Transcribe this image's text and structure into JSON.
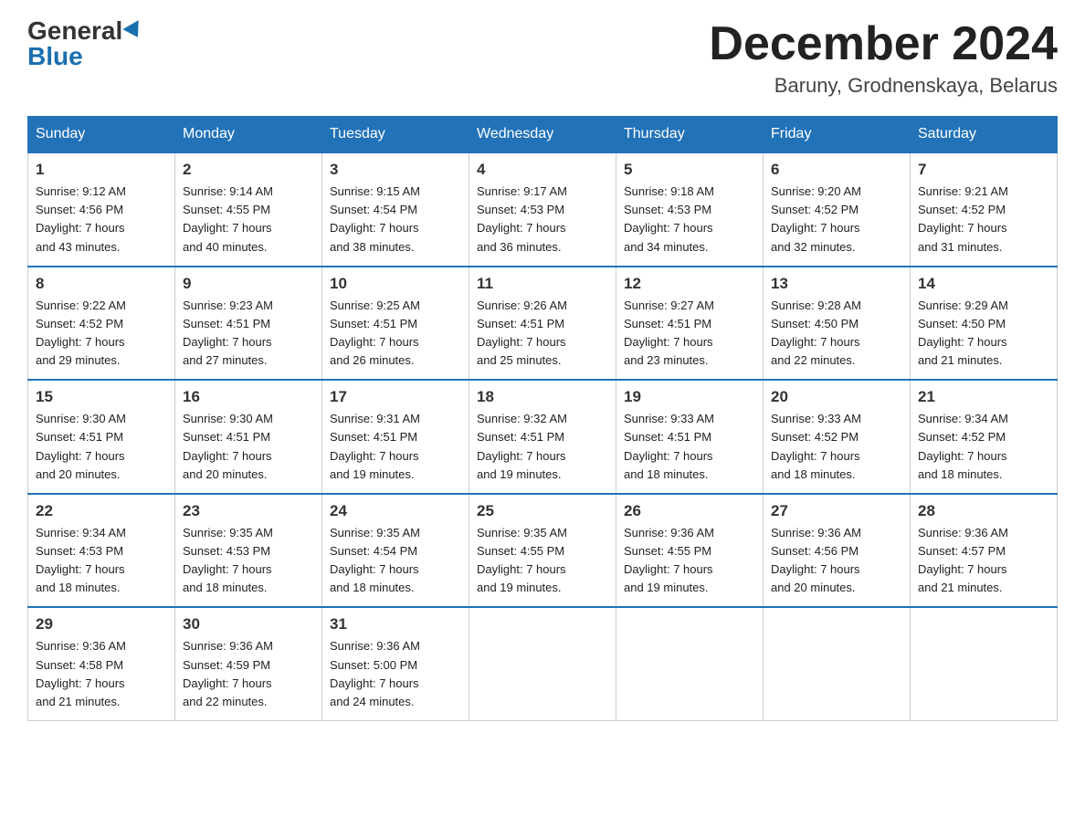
{
  "header": {
    "logo_general": "General",
    "logo_blue": "Blue",
    "month_title": "December 2024",
    "location": "Baruny, Grodnenskaya, Belarus"
  },
  "days_of_week": [
    "Sunday",
    "Monday",
    "Tuesday",
    "Wednesday",
    "Thursday",
    "Friday",
    "Saturday"
  ],
  "weeks": [
    [
      {
        "day": "1",
        "sunrise": "9:12 AM",
        "sunset": "4:56 PM",
        "daylight": "7 hours and 43 minutes."
      },
      {
        "day": "2",
        "sunrise": "9:14 AM",
        "sunset": "4:55 PM",
        "daylight": "7 hours and 40 minutes."
      },
      {
        "day": "3",
        "sunrise": "9:15 AM",
        "sunset": "4:54 PM",
        "daylight": "7 hours and 38 minutes."
      },
      {
        "day": "4",
        "sunrise": "9:17 AM",
        "sunset": "4:53 PM",
        "daylight": "7 hours and 36 minutes."
      },
      {
        "day": "5",
        "sunrise": "9:18 AM",
        "sunset": "4:53 PM",
        "daylight": "7 hours and 34 minutes."
      },
      {
        "day": "6",
        "sunrise": "9:20 AM",
        "sunset": "4:52 PM",
        "daylight": "7 hours and 32 minutes."
      },
      {
        "day": "7",
        "sunrise": "9:21 AM",
        "sunset": "4:52 PM",
        "daylight": "7 hours and 31 minutes."
      }
    ],
    [
      {
        "day": "8",
        "sunrise": "9:22 AM",
        "sunset": "4:52 PM",
        "daylight": "7 hours and 29 minutes."
      },
      {
        "day": "9",
        "sunrise": "9:23 AM",
        "sunset": "4:51 PM",
        "daylight": "7 hours and 27 minutes."
      },
      {
        "day": "10",
        "sunrise": "9:25 AM",
        "sunset": "4:51 PM",
        "daylight": "7 hours and 26 minutes."
      },
      {
        "day": "11",
        "sunrise": "9:26 AM",
        "sunset": "4:51 PM",
        "daylight": "7 hours and 25 minutes."
      },
      {
        "day": "12",
        "sunrise": "9:27 AM",
        "sunset": "4:51 PM",
        "daylight": "7 hours and 23 minutes."
      },
      {
        "day": "13",
        "sunrise": "9:28 AM",
        "sunset": "4:50 PM",
        "daylight": "7 hours and 22 minutes."
      },
      {
        "day": "14",
        "sunrise": "9:29 AM",
        "sunset": "4:50 PM",
        "daylight": "7 hours and 21 minutes."
      }
    ],
    [
      {
        "day": "15",
        "sunrise": "9:30 AM",
        "sunset": "4:51 PM",
        "daylight": "7 hours and 20 minutes."
      },
      {
        "day": "16",
        "sunrise": "9:30 AM",
        "sunset": "4:51 PM",
        "daylight": "7 hours and 20 minutes."
      },
      {
        "day": "17",
        "sunrise": "9:31 AM",
        "sunset": "4:51 PM",
        "daylight": "7 hours and 19 minutes."
      },
      {
        "day": "18",
        "sunrise": "9:32 AM",
        "sunset": "4:51 PM",
        "daylight": "7 hours and 19 minutes."
      },
      {
        "day": "19",
        "sunrise": "9:33 AM",
        "sunset": "4:51 PM",
        "daylight": "7 hours and 18 minutes."
      },
      {
        "day": "20",
        "sunrise": "9:33 AM",
        "sunset": "4:52 PM",
        "daylight": "7 hours and 18 minutes."
      },
      {
        "day": "21",
        "sunrise": "9:34 AM",
        "sunset": "4:52 PM",
        "daylight": "7 hours and 18 minutes."
      }
    ],
    [
      {
        "day": "22",
        "sunrise": "9:34 AM",
        "sunset": "4:53 PM",
        "daylight": "7 hours and 18 minutes."
      },
      {
        "day": "23",
        "sunrise": "9:35 AM",
        "sunset": "4:53 PM",
        "daylight": "7 hours and 18 minutes."
      },
      {
        "day": "24",
        "sunrise": "9:35 AM",
        "sunset": "4:54 PM",
        "daylight": "7 hours and 18 minutes."
      },
      {
        "day": "25",
        "sunrise": "9:35 AM",
        "sunset": "4:55 PM",
        "daylight": "7 hours and 19 minutes."
      },
      {
        "day": "26",
        "sunrise": "9:36 AM",
        "sunset": "4:55 PM",
        "daylight": "7 hours and 19 minutes."
      },
      {
        "day": "27",
        "sunrise": "9:36 AM",
        "sunset": "4:56 PM",
        "daylight": "7 hours and 20 minutes."
      },
      {
        "day": "28",
        "sunrise": "9:36 AM",
        "sunset": "4:57 PM",
        "daylight": "7 hours and 21 minutes."
      }
    ],
    [
      {
        "day": "29",
        "sunrise": "9:36 AM",
        "sunset": "4:58 PM",
        "daylight": "7 hours and 21 minutes."
      },
      {
        "day": "30",
        "sunrise": "9:36 AM",
        "sunset": "4:59 PM",
        "daylight": "7 hours and 22 minutes."
      },
      {
        "day": "31",
        "sunrise": "9:36 AM",
        "sunset": "5:00 PM",
        "daylight": "7 hours and 24 minutes."
      },
      null,
      null,
      null,
      null
    ]
  ],
  "labels": {
    "sunrise": "Sunrise:",
    "sunset": "Sunset:",
    "daylight": "Daylight:"
  }
}
